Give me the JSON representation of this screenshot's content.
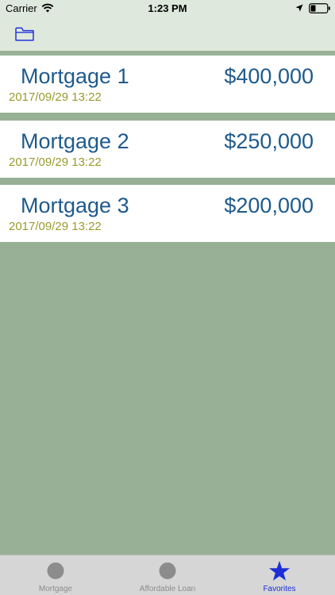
{
  "status_bar": {
    "carrier": "Carrier",
    "time": "1:23 PM"
  },
  "nav_bar": {
    "icon": "folder-icon",
    "accent_color": "#2233dd"
  },
  "mortgages": [
    {
      "name": "Mortgage 1",
      "amount": "$400,000",
      "date": "2017/09/29 13:22"
    },
    {
      "name": "Mortgage 2",
      "amount": "$250,000",
      "date": "2017/09/29 13:22"
    },
    {
      "name": "Mortgage 3",
      "amount": "$200,000",
      "date": "2017/09/29 13:22"
    }
  ],
  "tab_bar": {
    "tabs": [
      {
        "label": "Mortgage",
        "icon": "circle-icon",
        "active": false
      },
      {
        "label": "Affordable Loan",
        "icon": "circle-icon",
        "active": false
      },
      {
        "label": "Favorites",
        "icon": "star-icon",
        "active": true
      }
    ]
  },
  "colors": {
    "background": "#98b196",
    "bar_background": "#dfe8dc",
    "title_text": "#1f5a8c",
    "date_text": "#9a9a2e",
    "active_tab": "#1d2ed6",
    "inactive_tab": "#8c8c8c"
  }
}
